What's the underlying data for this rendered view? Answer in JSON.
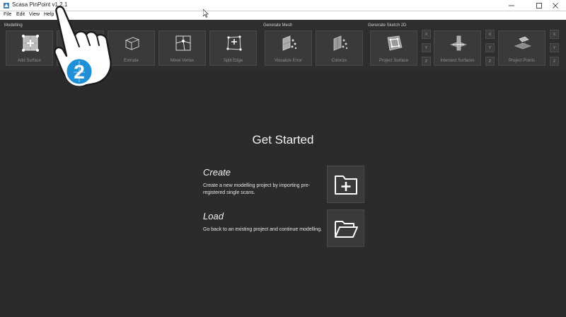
{
  "window": {
    "title": "Scasa PinPoint v1.2.1"
  },
  "menu": {
    "items": [
      "File",
      "Edit",
      "View",
      "Help"
    ]
  },
  "toolbar": {
    "modelling": {
      "label": "Modelling",
      "tools": [
        "Add Surface",
        "",
        "Extrude",
        "Move Vertex",
        "Split Edge"
      ]
    },
    "mesh": {
      "label": "Generate Mesh",
      "tools": [
        "Visualize Error",
        "Colorize"
      ]
    },
    "sketch": {
      "label": "Generate Sketch 2D",
      "tools": [
        "Project Surface",
        "Intersect Surfaces",
        "Project Points"
      ],
      "axes": [
        "X",
        "Y",
        "Z"
      ]
    }
  },
  "main": {
    "heading": "Get Started",
    "create": {
      "title": "Create",
      "description": "Create a new modelling project by importing pre-registered single scans."
    },
    "load": {
      "title": "Load",
      "description": "Go back to an existing project and continue modelling."
    }
  },
  "overlay": {
    "step_number": "2",
    "icon": "pointing-hand-icon"
  }
}
